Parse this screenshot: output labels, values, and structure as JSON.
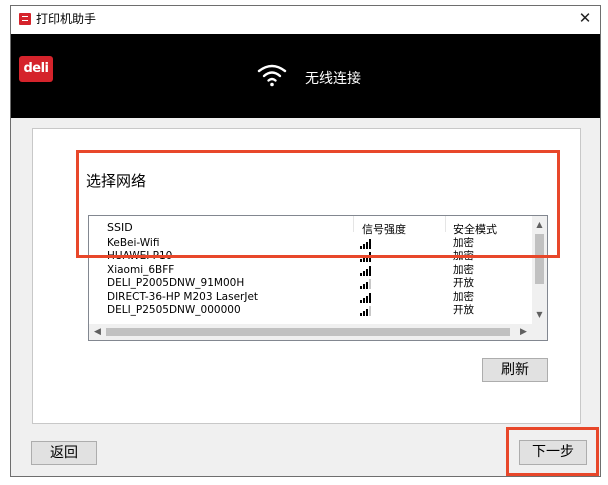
{
  "window": {
    "title": "打印机助手",
    "close_label": "✕"
  },
  "header": {
    "logo_text": "deli",
    "title": "无线连接"
  },
  "main": {
    "section_title": "选择网络",
    "columns": [
      "SSID",
      "信号强度",
      "安全模式"
    ],
    "networks": [
      {
        "ssid": "KeBei-Wifi",
        "signal": 4,
        "security": "加密"
      },
      {
        "ssid": "HUAWEI P10",
        "signal": 4,
        "security": "加密"
      },
      {
        "ssid": "Xiaomi_6BFF",
        "signal": 4,
        "security": "加密"
      },
      {
        "ssid": "DELI_P2005DNW_91M00H",
        "signal": 3,
        "security": "开放"
      },
      {
        "ssid": "DIRECT-36-HP M203 LaserJet",
        "signal": 4,
        "security": "加密"
      },
      {
        "ssid": "DELI_P2505DNW_000000",
        "signal": 3,
        "security": "开放"
      }
    ],
    "refresh_label": "刷新"
  },
  "footer": {
    "back_label": "返回",
    "next_label": "下一步"
  },
  "colors": {
    "header_bg": "#000000",
    "brand_red": "#d5232b",
    "highlight": "#e8472a"
  },
  "icons": [
    "app-icon",
    "wifi-icon",
    "signal-icon",
    "scroll-up-icon",
    "scroll-down-icon",
    "scroll-left-icon",
    "scroll-right-icon",
    "close-icon"
  ]
}
